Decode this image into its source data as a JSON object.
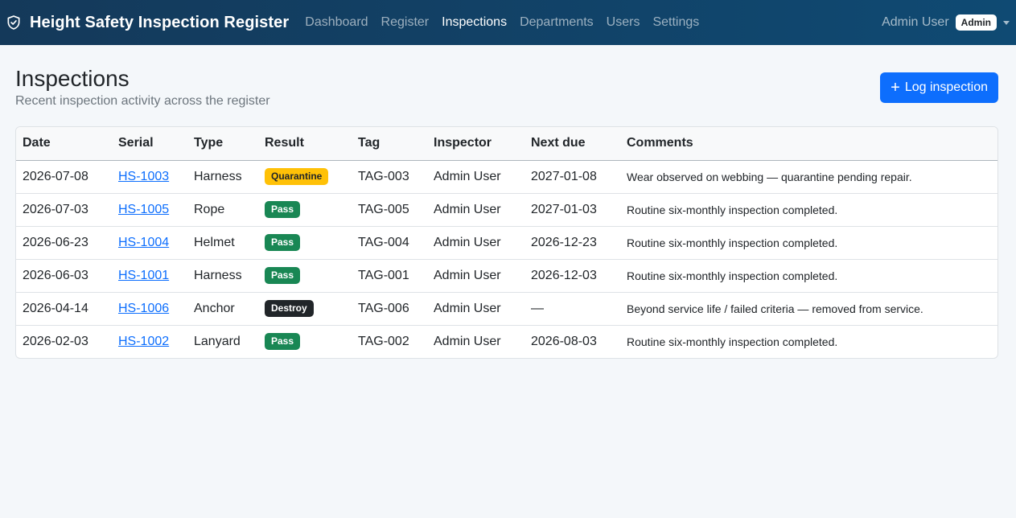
{
  "nav": {
    "brand": "Height Safety Inspection Register",
    "links": [
      {
        "label": "Dashboard",
        "active": false
      },
      {
        "label": "Register",
        "active": false
      },
      {
        "label": "Inspections",
        "active": true
      },
      {
        "label": "Departments",
        "active": false
      },
      {
        "label": "Users",
        "active": false
      },
      {
        "label": "Settings",
        "active": false
      }
    ],
    "user": {
      "name": "Admin User",
      "role": "Admin"
    }
  },
  "page": {
    "title": "Inspections",
    "subtitle": "Recent inspection activity across the register",
    "action_icon": "+",
    "action_label": "Log inspection"
  },
  "table": {
    "headers": [
      "Date",
      "Serial",
      "Type",
      "Result",
      "Tag",
      "Inspector",
      "Next due",
      "Comments"
    ],
    "rows": [
      {
        "date": "2026-07-08",
        "serial": "HS-1003",
        "type": "Harness",
        "result": "Quarantine",
        "result_style": "quarantine",
        "tag": "TAG-003",
        "inspector": "Admin User",
        "next_due": "2027-01-08",
        "comments": "Wear observed on webbing — quarantine pending repair."
      },
      {
        "date": "2026-07-03",
        "serial": "HS-1005",
        "type": "Rope",
        "result": "Pass",
        "result_style": "pass",
        "tag": "TAG-005",
        "inspector": "Admin User",
        "next_due": "2027-01-03",
        "comments": "Routine six-monthly inspection completed."
      },
      {
        "date": "2026-06-23",
        "serial": "HS-1004",
        "type": "Helmet",
        "result": "Pass",
        "result_style": "pass",
        "tag": "TAG-004",
        "inspector": "Admin User",
        "next_due": "2026-12-23",
        "comments": "Routine six-monthly inspection completed."
      },
      {
        "date": "2026-06-03",
        "serial": "HS-1001",
        "type": "Harness",
        "result": "Pass",
        "result_style": "pass",
        "tag": "TAG-001",
        "inspector": "Admin User",
        "next_due": "2026-12-03",
        "comments": "Routine six-monthly inspection completed."
      },
      {
        "date": "2026-04-14",
        "serial": "HS-1006",
        "type": "Anchor",
        "result": "Destroy",
        "result_style": "destroy",
        "tag": "TAG-006",
        "inspector": "Admin User",
        "next_due": "—",
        "comments": "Beyond service life / failed criteria — removed from service."
      },
      {
        "date": "2026-02-03",
        "serial": "HS-1002",
        "type": "Lanyard",
        "result": "Pass",
        "result_style": "pass",
        "tag": "TAG-002",
        "inspector": "Admin User",
        "next_due": "2026-08-03",
        "comments": "Routine six-monthly inspection completed."
      }
    ]
  },
  "colors": {
    "navbar": "#14395a",
    "primary": "#0d6efd",
    "pass": "#198754",
    "quarantine": "#ffc107",
    "destroy": "#212529"
  },
  "icons": {
    "brand": "shield-check-icon",
    "action": "plus-icon",
    "dropdown": "caret-down-icon"
  }
}
